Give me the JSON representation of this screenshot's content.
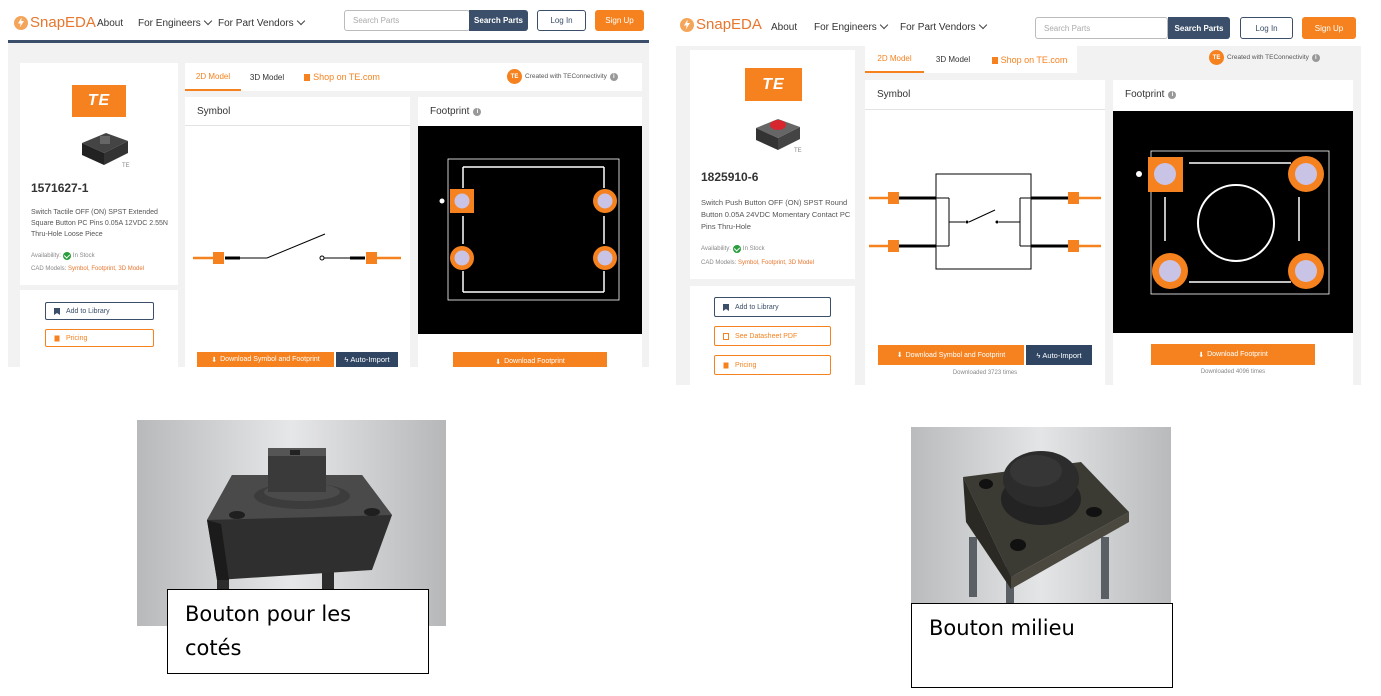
{
  "nav": {
    "logo": "SnapEDA",
    "about": "About",
    "for_engineers": "For Engineers",
    "for_vendors": "For Part Vendors",
    "search_placeholder": "Search Parts",
    "search_button": "Search Parts",
    "login": "Log In",
    "signup": "Sign Up"
  },
  "left": {
    "brand": "TE",
    "part_number": "1571627-1",
    "description": "Switch Tactile OFF (ON) SPST Extended Square Button PC Pins 0.05A 12VDC 2.55N Thru-Hole Loose Piece",
    "availability_label": "Availability:",
    "availability_value": "In Stock",
    "cad_label": "CAD Models:",
    "cad_links": "Symbol, Footprint, 3D Model",
    "buttons": {
      "library": "Add to Library",
      "pricing": "Pricing"
    },
    "tabs": {
      "model2d": "2D Model",
      "model3d": "3D Model",
      "shop": "Shop on TE.com"
    },
    "credit": "Created with TEConnectivity",
    "symbol_title": "Symbol",
    "footprint_title": "Footprint",
    "download_sym": "Download Symbol and Footprint",
    "auto_import": "Auto-Import",
    "download_fp": "Download Footprint"
  },
  "right": {
    "brand": "TE",
    "part_number": "1825910-6",
    "description": "Switch Push Button OFF (ON) SPST Round Button 0.05A 24VDC Momentary Contact PC Pins Thru-Hole",
    "availability_label": "Availability:",
    "availability_value": "In Stock",
    "cad_label": "CAD Models:",
    "cad_links": "Symbol, Footprint, 3D Model",
    "buttons": {
      "library": "Add to Library",
      "datasheet": "See Datasheet PDF",
      "pricing": "Pricing"
    },
    "tabs": {
      "model2d": "2D Model",
      "model3d": "3D Model",
      "shop": "Shop on TE.com"
    },
    "credit": "Created with TEConnectivity",
    "symbol_title": "Symbol",
    "footprint_title": "Footprint",
    "download_sym": "Download Symbol and Footprint",
    "auto_import": "Auto-Import",
    "download_fp": "Download Footprint",
    "downloads_sym": "Downloaded 3723 times",
    "downloads_fp": "Downloaded 4096 times"
  },
  "captions": {
    "side_button_line1": "Bouton pour les",
    "side_button_line2": "cotés",
    "middle_button": "Bouton milieu"
  },
  "colors": {
    "brand_orange": "#f5821f",
    "navy": "#3b4f6a",
    "in_stock_green": "#2a9d3c"
  },
  "icons": [
    "snapeda-logo-icon",
    "chevron-down-icon",
    "bookmark-icon",
    "pdf-icon",
    "price-tag-icon",
    "download-icon",
    "bolt-icon",
    "info-icon",
    "check-circle-icon"
  ]
}
